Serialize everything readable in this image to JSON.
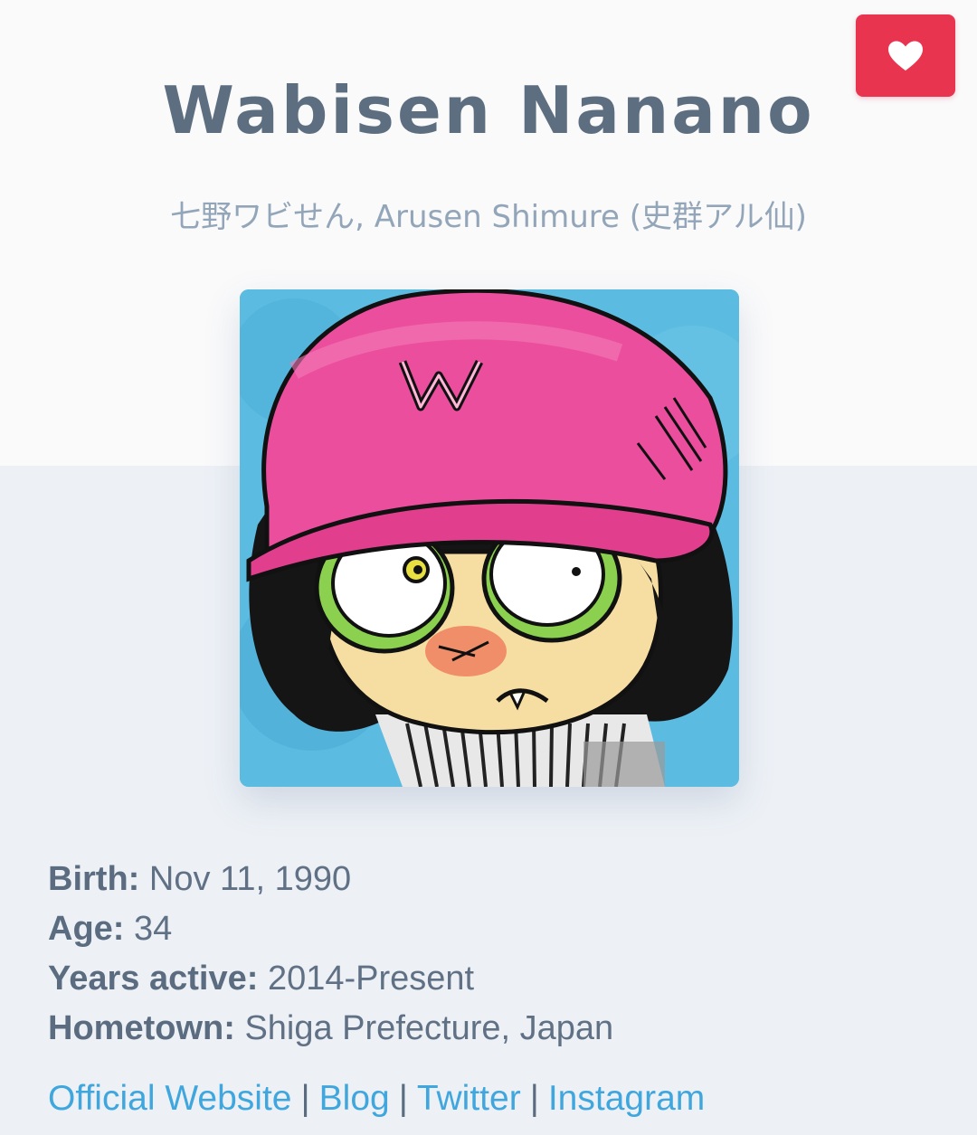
{
  "profile": {
    "name": "Wabisen Nanano",
    "aliases": "七野ワビせん, Arusen Shimure (史群アル仙)",
    "portrait_icon": "artist-portrait-illustration"
  },
  "favorite": {
    "icon": "heart-icon",
    "color": "#e8344e"
  },
  "info": {
    "birth_label": "Birth:",
    "birth_value": "Nov 11, 1990",
    "age_label": "Age:",
    "age_value": "34",
    "years_label": "Years active:",
    "years_value": "2014-Present",
    "hometown_label": "Hometown:",
    "hometown_value": "Shiga Prefecture, Japan"
  },
  "links": {
    "official": "Official Website",
    "blog": "Blog",
    "twitter": "Twitter",
    "instagram": "Instagram",
    "separator": "|",
    "color": "#3fa6de"
  }
}
